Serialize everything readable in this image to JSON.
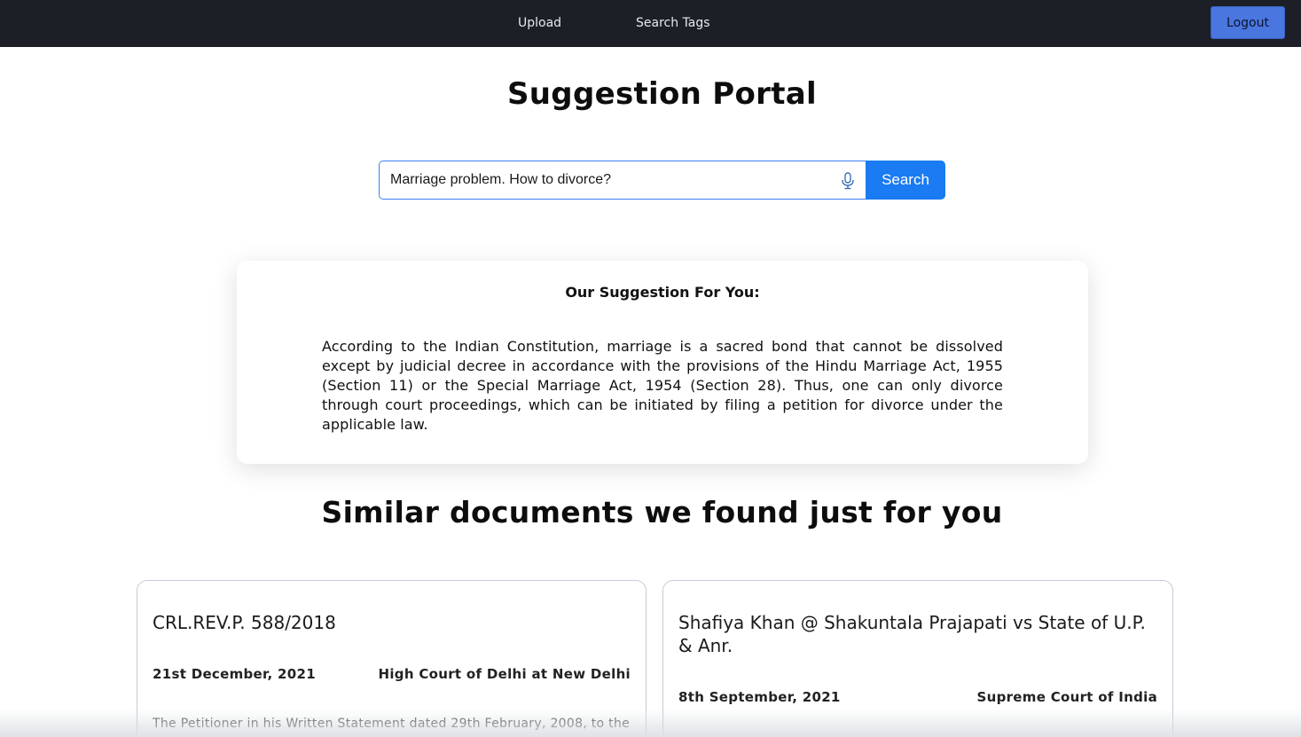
{
  "nav": {
    "upload": "Upload",
    "search_tags": "Search Tags",
    "logout": "Logout"
  },
  "page_title": "Suggestion Portal",
  "search": {
    "value": "Marriage problem. How to divorce?",
    "button": "Search",
    "mic_icon": "microphone-icon"
  },
  "suggestion": {
    "heading": "Our Suggestion For You:",
    "body": "According to the Indian Constitution, marriage is a sacred bond that cannot be dissolved except by judicial decree in accordance with the provisions of the Hindu Marriage Act, 1955 (Section 11) or the Special Marriage Act, 1954 (Section 28). Thus, one can only divorce through court proceedings, which can be initiated by filing a petition for divorce under the applicable law."
  },
  "similar_heading": "Similar documents we found just for you",
  "documents": [
    {
      "title": "CRL.REV.P. 588/2018",
      "date": "21st December, 2021",
      "court": "High Court of Delhi at New Delhi",
      "snippet": "The Petitioner in his Written Statement dated 29th February, 2008, to the"
    },
    {
      "title": "Shafiya Khan @ Shakuntala Prajapati vs State of U.P. & Anr.",
      "date": "8th September, 2021",
      "court": "Supreme Court of India"
    }
  ],
  "colors": {
    "navbar": "#1c1f26",
    "logout_button": "#4a76e0",
    "search_button": "#1a7bf2",
    "input_border": "#3b82f6"
  }
}
